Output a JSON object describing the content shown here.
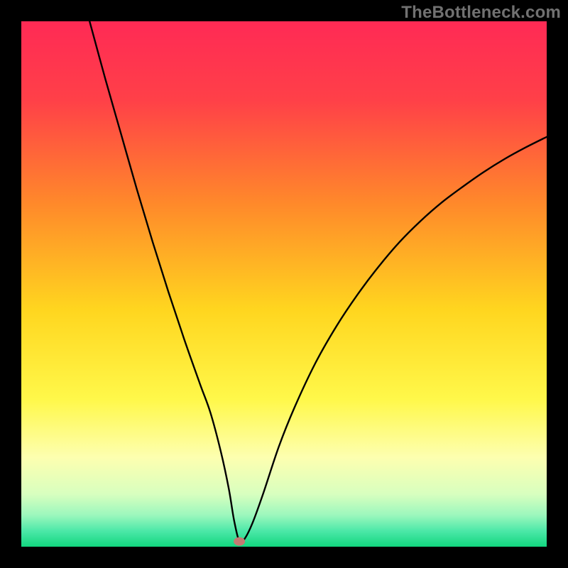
{
  "watermark": "TheBottleneck.com",
  "chart_data": {
    "type": "line",
    "title": "",
    "xlabel": "",
    "ylabel": "",
    "xlim": [
      0,
      100
    ],
    "ylim": [
      0,
      100
    ],
    "background_gradient": {
      "stops": [
        {
          "offset": 0.0,
          "color": "#ff2a55"
        },
        {
          "offset": 0.15,
          "color": "#ff4048"
        },
        {
          "offset": 0.35,
          "color": "#ff8a2a"
        },
        {
          "offset": 0.55,
          "color": "#ffd61f"
        },
        {
          "offset": 0.72,
          "color": "#fff84a"
        },
        {
          "offset": 0.83,
          "color": "#fdffb0"
        },
        {
          "offset": 0.9,
          "color": "#d8ffbf"
        },
        {
          "offset": 0.94,
          "color": "#9cf7bd"
        },
        {
          "offset": 0.97,
          "color": "#4ce8a8"
        },
        {
          "offset": 1.0,
          "color": "#12d67f"
        }
      ]
    },
    "marker": {
      "x": 41.5,
      "y": 1.0,
      "color": "#c47a72"
    },
    "series": [
      {
        "name": "curve",
        "x": [
          13,
          16,
          19,
          22,
          25,
          28,
          31,
          34,
          36,
          38,
          39.5,
          40.5,
          41.5,
          42.5,
          44,
          46,
          49,
          52,
          56,
          60,
          64,
          68,
          72,
          76,
          80,
          84,
          88,
          92,
          96,
          100
        ],
        "y": [
          100,
          89,
          78.5,
          68,
          58,
          48.5,
          39.5,
          31,
          25.5,
          18,
          11,
          5,
          1,
          1.5,
          4.5,
          10,
          19,
          26.5,
          35,
          42,
          48,
          53.3,
          58,
          62,
          65.5,
          68.5,
          71.3,
          73.8,
          76,
          78
        ]
      }
    ]
  }
}
